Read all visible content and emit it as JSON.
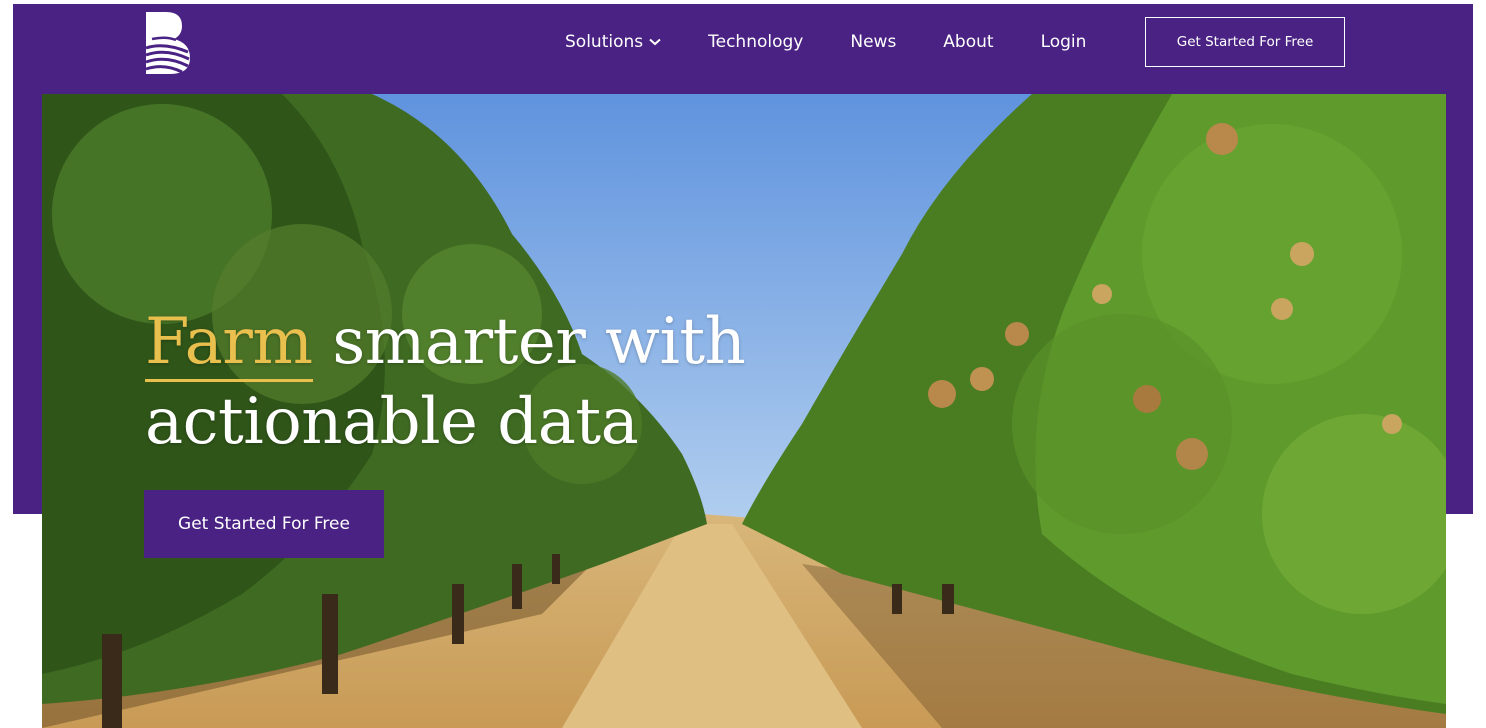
{
  "nav": {
    "items": [
      {
        "label": "Solutions",
        "has_dropdown": true
      },
      {
        "label": "Technology"
      },
      {
        "label": "News"
      },
      {
        "label": "About"
      },
      {
        "label": "Login"
      }
    ],
    "cta_label": "Get Started For Free"
  },
  "hero": {
    "headline_accent": "Farm",
    "headline_rest": " smarter with actionable data",
    "cta_label": "Get Started For Free"
  },
  "colors": {
    "brand_purple": "#4a2283",
    "accent_gold": "#e9bf4d",
    "text_white": "#ffffff"
  },
  "icons": {
    "logo": "brand-b-logo",
    "dropdown": "chevron-down-icon"
  }
}
